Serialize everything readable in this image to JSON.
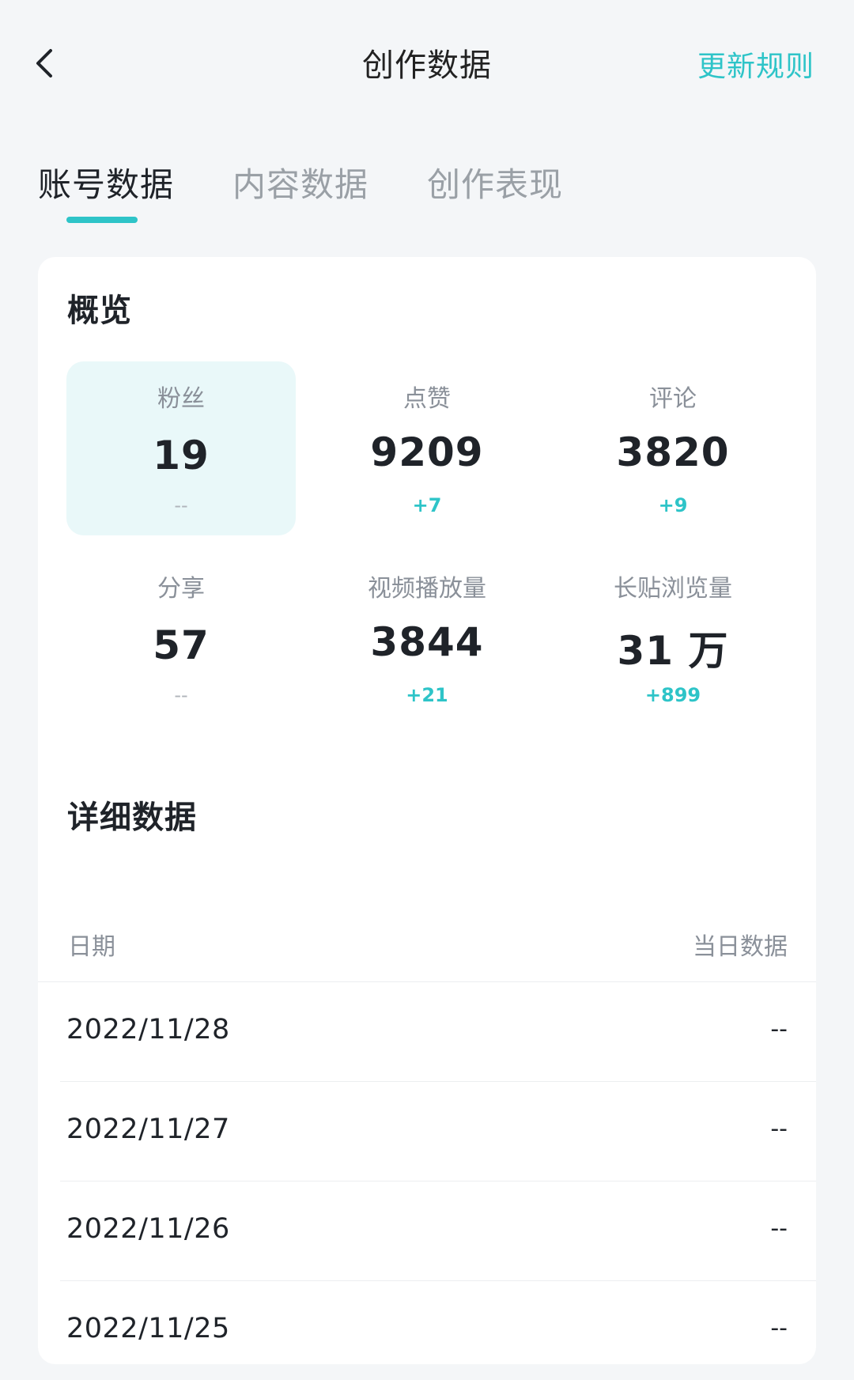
{
  "header": {
    "title": "创作数据",
    "action_label": "更新规则"
  },
  "tabs": [
    {
      "label": "账号数据",
      "active": true
    },
    {
      "label": "内容数据",
      "active": false
    },
    {
      "label": "创作表现",
      "active": false
    }
  ],
  "colors": {
    "accent": "#2ec4c8",
    "selected_bg": "#e9f8f9"
  },
  "overview": {
    "title": "概览",
    "stats": [
      {
        "label": "粉丝",
        "value": "19",
        "delta": "--",
        "selected": true
      },
      {
        "label": "点赞",
        "value": "9209",
        "delta": "+7",
        "selected": false
      },
      {
        "label": "评论",
        "value": "3820",
        "delta": "+9",
        "selected": false
      },
      {
        "label": "分享",
        "value": "57",
        "delta": "--",
        "selected": false
      },
      {
        "label": "视频播放量",
        "value": "3844",
        "delta": "+21",
        "selected": false
      },
      {
        "label": "长贴浏览量",
        "value": "31 万",
        "delta": "+899",
        "selected": false
      }
    ]
  },
  "details": {
    "title": "详细数据",
    "columns": [
      "日期",
      "当日数据"
    ],
    "rows": [
      {
        "date": "2022/11/28",
        "value": "--"
      },
      {
        "date": "2022/11/27",
        "value": "--"
      },
      {
        "date": "2022/11/26",
        "value": "--"
      },
      {
        "date": "2022/11/25",
        "value": "--"
      }
    ]
  }
}
